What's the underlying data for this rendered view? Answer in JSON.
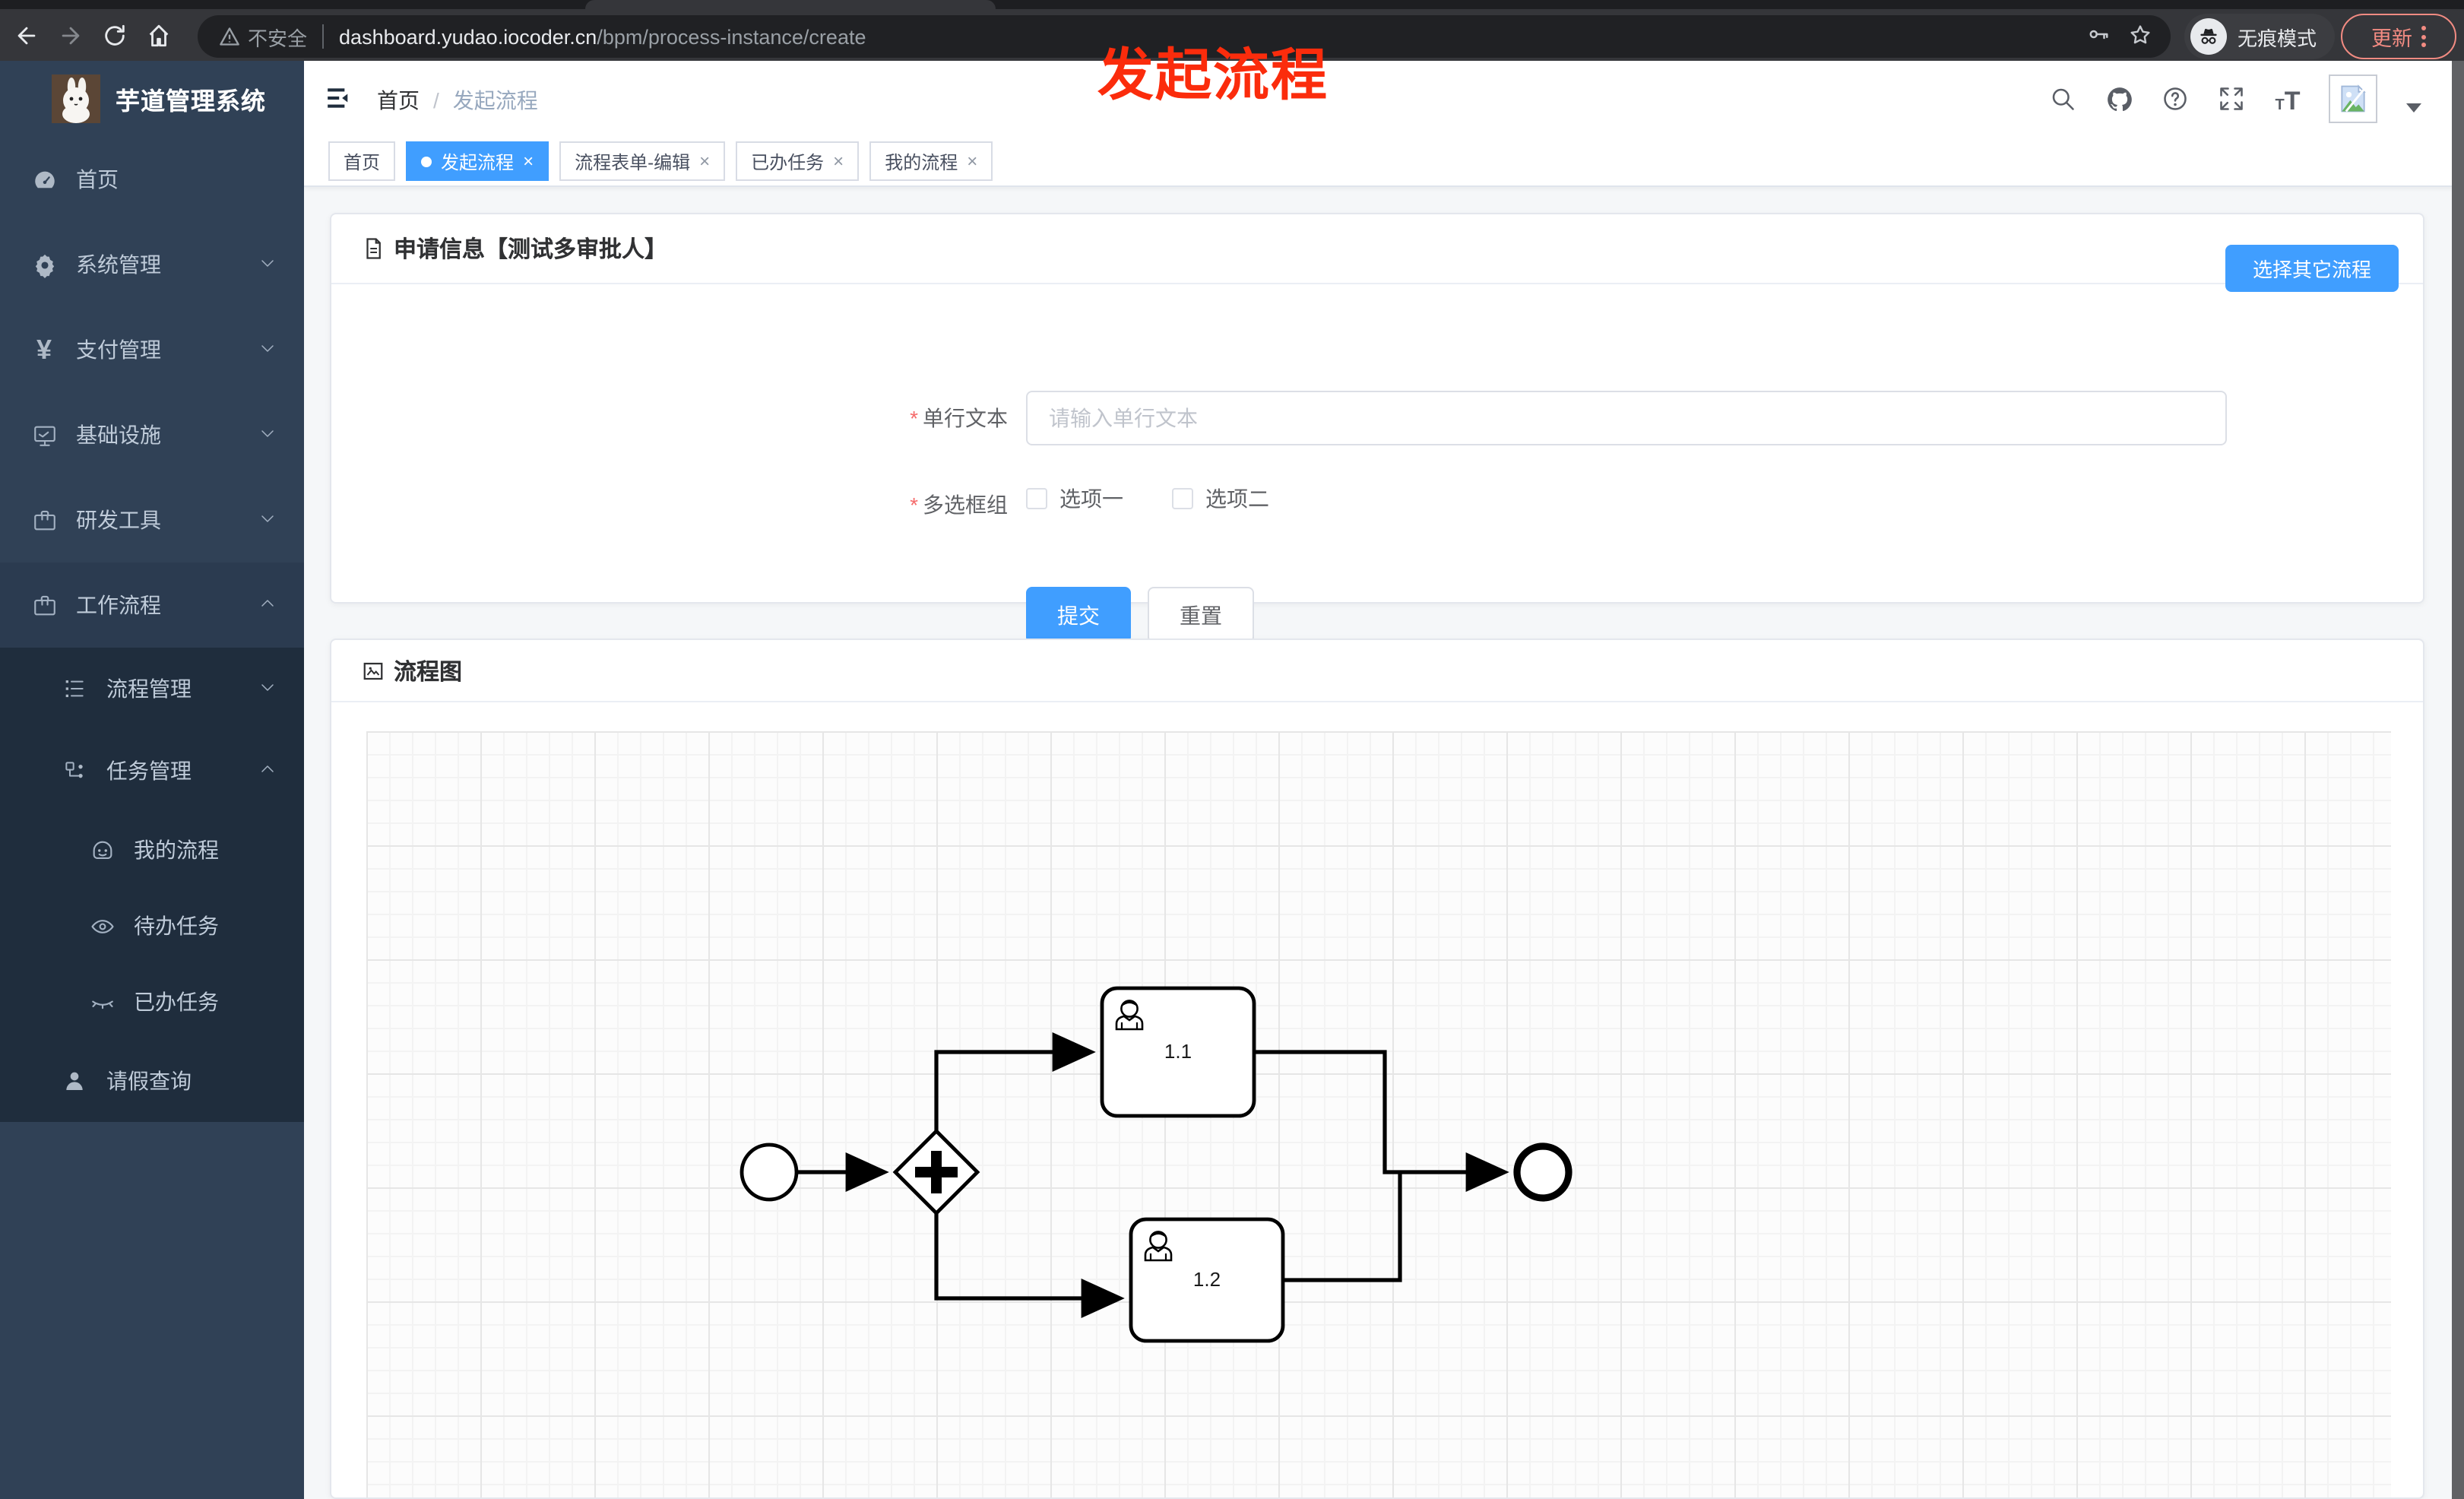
{
  "browser": {
    "security_label": "不安全",
    "url_host": "dashboard.yudao.iocoder.cn",
    "url_path": "/bpm/process-instance/create",
    "incognito_label": "无痕模式",
    "update_label": "更新"
  },
  "overlay": {
    "annotation": "发起流程",
    "color": "#fb2c0c"
  },
  "sidebar": {
    "title": "芋道管理系统",
    "items": [
      {
        "label": "首页"
      },
      {
        "label": "系统管理"
      },
      {
        "label": "支付管理"
      },
      {
        "label": "基础设施"
      },
      {
        "label": "研发工具"
      },
      {
        "label": "工作流程"
      }
    ],
    "submenu": [
      {
        "label": "流程管理"
      },
      {
        "label": "任务管理"
      },
      {
        "label": "我的流程"
      },
      {
        "label": "待办任务"
      },
      {
        "label": "已办任务"
      },
      {
        "label": "请假查询"
      }
    ]
  },
  "header": {
    "breadcrumb": [
      "首页",
      "发起流程"
    ],
    "separator": "/"
  },
  "tabs": [
    {
      "label": "首页"
    },
    {
      "label": "发起流程",
      "active": true
    },
    {
      "label": "流程表单-编辑"
    },
    {
      "label": "已办任务"
    },
    {
      "label": "我的流程"
    }
  ],
  "form_card": {
    "title": "申请信息【测试多审批人】",
    "switch_button": "选择其它流程",
    "text_field": {
      "label": "单行文本",
      "placeholder": "请输入单行文本",
      "value": ""
    },
    "checkbox_group": {
      "label": "多选框组",
      "options": [
        {
          "label": "选项一",
          "checked": false
        },
        {
          "label": "选项二",
          "checked": false
        }
      ]
    },
    "submit_label": "提交",
    "reset_label": "重置"
  },
  "flow_card": {
    "title": "流程图",
    "bpmn": {
      "type": "user-task-parallel-split",
      "tasks": [
        {
          "label": "1.1"
        },
        {
          "label": "1.2"
        }
      ]
    }
  },
  "icons": {
    "back-icon": "left arrow",
    "forward-icon": "right arrow",
    "reload-icon": "circular arrow",
    "home-icon": "house",
    "warning-icon": "triangle !",
    "key-icon": "key",
    "star-icon": "star",
    "incognito-icon": "hat and glasses",
    "more-dots-icon": "vertical dots",
    "dashboard-icon": "gauge",
    "gear-icon": "gear",
    "yen-icon": "¥",
    "monitor-icon": "screen",
    "toolbox-icon": "briefcase",
    "tree-icon": "tree list",
    "flow-node-icon": "linked nodes",
    "face-icon": "face",
    "eye-icon": "eye",
    "eye-closed-icon": "closed eye",
    "person-icon": "person",
    "hamburger-icon": "collapse menu",
    "search-icon": "magnifier",
    "github-icon": "octocat",
    "help-icon": "question circle",
    "fullscreen-icon": "expand arrows",
    "font-size-icon": "Tt",
    "broken-image-icon": "image placeholder",
    "document-icon": "document",
    "picture-icon": "picture"
  },
  "colors": {
    "primary": "#409eff",
    "danger": "#f56c6c",
    "annotation": "#fb2c0c",
    "sidebar_bg": "#304156",
    "submenu_bg": "#1f2d3d",
    "menu_text": "#bfcbd9"
  }
}
